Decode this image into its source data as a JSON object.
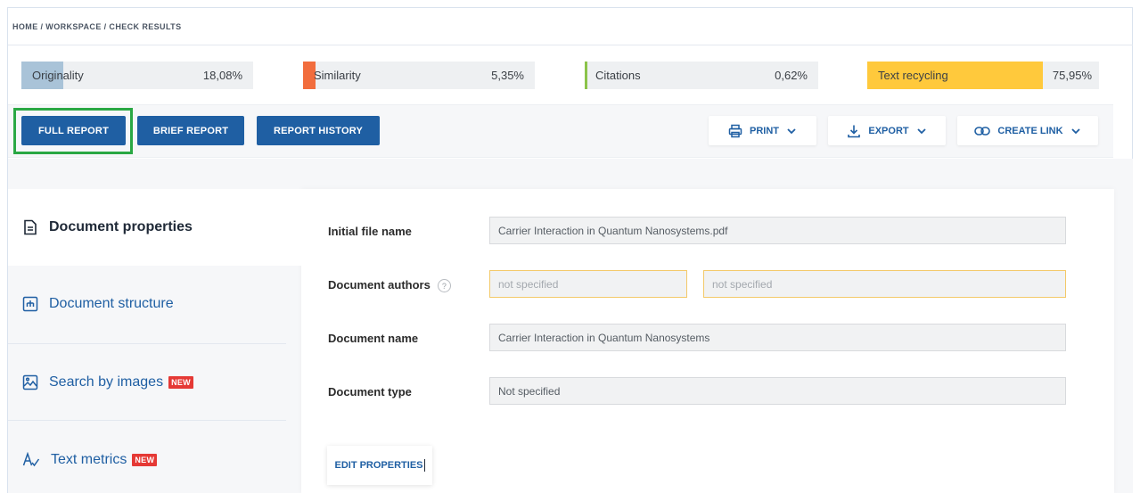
{
  "breadcrumb": "HOME / WORKSPACE / CHECK RESULTS",
  "metrics": [
    {
      "label": "Originality",
      "value": "18,08%",
      "fraction": 0.1808,
      "color": "#a9c3d8"
    },
    {
      "label": "Similarity",
      "value": "5,35%",
      "fraction": 0.0535,
      "color": "#f26d3d"
    },
    {
      "label": "Citations",
      "value": "0,62%",
      "fraction": 0.0062,
      "color": "#8bc34a"
    },
    {
      "label": "Text recycling",
      "value": "75,95%",
      "fraction": 0.7595,
      "color": "#ffc93c"
    }
  ],
  "toolbar": {
    "full_report": "FULL REPORT",
    "brief_report": "BRIEF REPORT",
    "report_history": "REPORT HISTORY",
    "print": "PRINT",
    "export": "EXPORT",
    "create_link": "CREATE LINK"
  },
  "sidebar": {
    "items": [
      {
        "label": "Document properties",
        "icon": "document-icon",
        "active": true
      },
      {
        "label": "Document structure",
        "icon": "structure-icon"
      },
      {
        "label": "Search by images",
        "icon": "image-icon",
        "badge": "NEW"
      },
      {
        "label": "Text metrics",
        "icon": "text-metrics-icon",
        "badge": "NEW"
      }
    ]
  },
  "properties": {
    "initial_file_name_label": "Initial file name",
    "initial_file_name": "Carrier Interaction in Quantum Nanosystems.pdf",
    "authors_label": "Document authors",
    "authors_help": "?",
    "author_1_placeholder": "not specified",
    "author_2_placeholder": "not specified",
    "document_name_label": "Document name",
    "document_name": "Carrier Interaction in Quantum Nanosystems",
    "document_type_label": "Document type",
    "document_type": "Not specified"
  },
  "edit_button": "EDIT PROPERTIES",
  "colors": {
    "primary": "#1f5fa3",
    "focus": "#2aa844",
    "badge": "#e53935"
  }
}
